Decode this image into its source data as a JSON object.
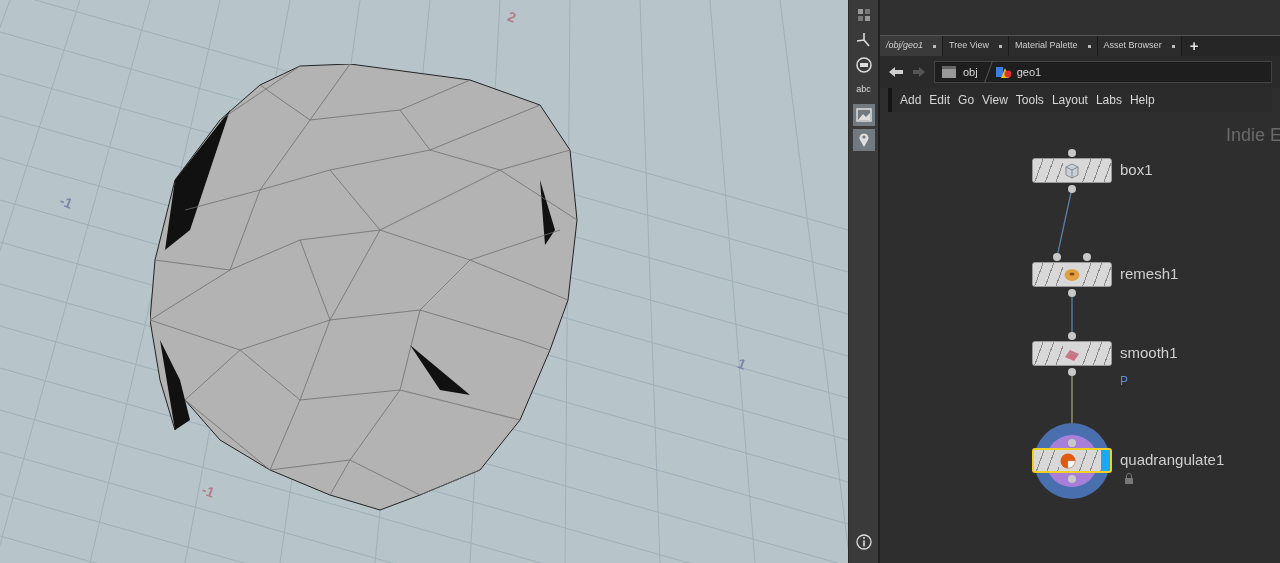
{
  "viewport": {
    "grid_labels": [
      {
        "text": "2",
        "color": "#b07f86"
      },
      {
        "text": "-1",
        "color": "#7c86a8"
      },
      {
        "text": "1",
        "color": "#7c86a8"
      },
      {
        "text": "-1",
        "color": "#b07f86"
      }
    ]
  },
  "toolbar": {
    "items": [
      {
        "kind": "grid",
        "selected": false
      },
      {
        "kind": "axes",
        "selected": false
      },
      {
        "kind": "circle",
        "selected": false
      },
      {
        "kind": "text",
        "label": "abc",
        "selected": false
      },
      {
        "kind": "image",
        "selected": true
      },
      {
        "kind": "pin",
        "selected": true
      }
    ],
    "bottom_items": [
      {
        "kind": "info",
        "selected": false
      }
    ]
  },
  "network": {
    "tabs": [
      {
        "label": "/obj/geo1",
        "selected": true
      },
      {
        "label": "Tree View",
        "selected": false
      },
      {
        "label": "Material Palette",
        "selected": false
      },
      {
        "label": "Asset Browser",
        "selected": false
      }
    ],
    "add_tab": "+",
    "path": [
      {
        "kind": "obj",
        "label": "obj"
      },
      {
        "kind": "geo",
        "label": "geo1"
      }
    ],
    "menu": [
      "Add",
      "Edit",
      "Go",
      "View",
      "Tools",
      "Layout",
      "Labs",
      "Help"
    ],
    "edition_label": "Indie E",
    "nodes": [
      {
        "name": "box1",
        "kind": "box",
        "selected": false,
        "display": false,
        "locked": false
      },
      {
        "name": "remesh1",
        "kind": "remesh",
        "selected": false,
        "display": false,
        "locked": false
      },
      {
        "name": "smooth1",
        "kind": "smooth",
        "selected": false,
        "display": false,
        "locked": false,
        "badge": "P"
      },
      {
        "name": "quadrangulate1",
        "kind": "quadrangulate",
        "selected": true,
        "display": true,
        "locked": true
      }
    ]
  }
}
